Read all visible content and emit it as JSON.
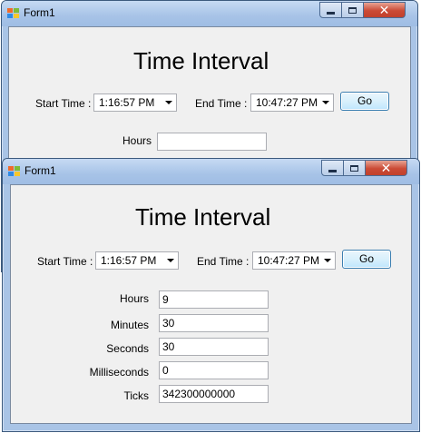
{
  "back_window": {
    "title": "Form1",
    "heading": "Time Interval",
    "start_label": "Start Time :",
    "start_value": "1:16:57 PM",
    "end_label": "End Time :",
    "end_value": "10:47:27 PM",
    "go_label": "Go",
    "hours_label": "Hours",
    "hours_value": ""
  },
  "front_window": {
    "title": "Form1",
    "heading": "Time Interval",
    "start_label": "Start Time :",
    "start_value": "1:16:57 PM",
    "end_label": "End Time :",
    "end_value": "10:47:27 PM",
    "go_label": "Go",
    "fields": [
      {
        "label": "Hours",
        "value": "9"
      },
      {
        "label": "Minutes",
        "value": "30"
      },
      {
        "label": "Seconds",
        "value": "30"
      },
      {
        "label": "Milliseconds",
        "value": "0"
      },
      {
        "label": "Ticks",
        "value": "342300000000"
      }
    ]
  },
  "window_controls": {
    "close_glyph": "✕"
  }
}
